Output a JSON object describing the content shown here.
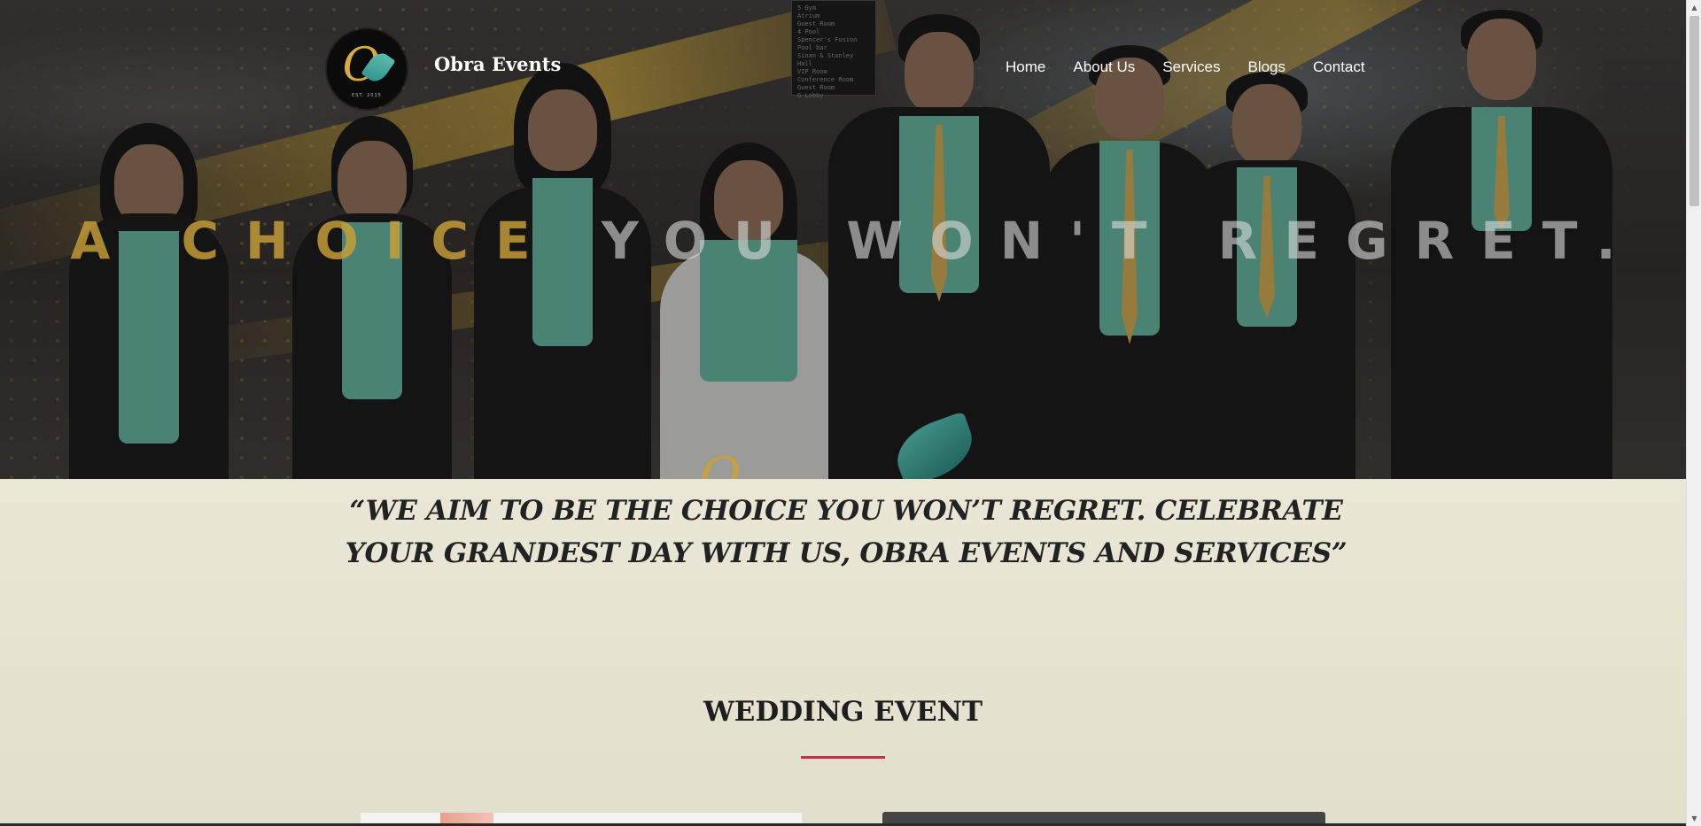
{
  "header": {
    "brand": "Obra Events",
    "logo_letter": "O",
    "logo_est": "EST. 2015",
    "nav": [
      "Home",
      "About Us",
      "Services",
      "Blogs",
      "Contact"
    ]
  },
  "hero": {
    "tagline_highlight": "A CHOICE",
    "tagline_rest": " YOU WON'T REGRET.",
    "elevator_sign": [
      "5 Gym",
      "Atrium",
      "Guest Room",
      "4 Pool",
      "Spencer's Fusion",
      "Pool bar",
      "Sinan & Stanley Hall",
      "VIP Room",
      "Conference Room",
      "Guest Room",
      "G Lobby"
    ]
  },
  "main": {
    "quote": "“WE AIM TO BE THE CHOICE YOU WON’T REGRET. CELEBRATE YOUR GRANDEST DAY WITH US, OBRA EVENTS AND SERVICES”",
    "section_title": "WEDDING EVENT"
  },
  "colors": {
    "accent_gold": "#c9a038",
    "underline_red": "#c0324b",
    "shirt_teal": "#5fae98",
    "background": "#e6e4d3"
  }
}
